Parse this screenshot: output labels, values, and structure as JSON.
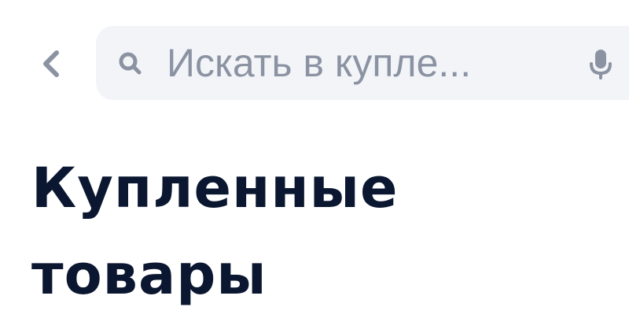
{
  "header": {
    "back_icon": "chevron-left-icon",
    "search": {
      "icon": "search-icon",
      "placeholder": "Искать в купле...",
      "value": "",
      "mic_icon": "microphone-icon"
    }
  },
  "page": {
    "title_line_1": "Купленные",
    "title_line_2": "товары"
  },
  "colors": {
    "title_text": "#0b1730",
    "search_background": "#f2f4f8",
    "placeholder_text": "#8b93a3",
    "icon": "#8b93a3"
  }
}
